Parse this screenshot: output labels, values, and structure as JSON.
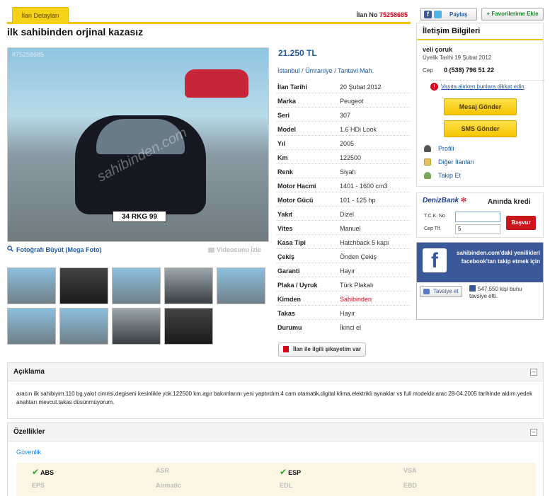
{
  "tabs": {
    "active": "İlan Detayları"
  },
  "listing": {
    "no_label": "İlan No",
    "no_value": "75258685",
    "title": "ilk sahibinden orjinal kazasız",
    "price": "21.250 TL",
    "location": [
      "İstanbul",
      "Ümraniye",
      "Tantavi Mah."
    ],
    "photo_watermark_id": "#75258685",
    "plate": "34 RKG 99",
    "watermark": "sahibinden.com"
  },
  "photo_actions": {
    "enlarge": "Fotoğrafı Büyüt (Mega Foto)",
    "video": "Videosunu İzle"
  },
  "details": [
    {
      "k": "İlan Tarihi",
      "v": "20 Şubat 2012"
    },
    {
      "k": "Marka",
      "v": "Peugeot"
    },
    {
      "k": "Seri",
      "v": "307"
    },
    {
      "k": "Model",
      "v": "1.6 HDi Look"
    },
    {
      "k": "Yıl",
      "v": "2005"
    },
    {
      "k": "Km",
      "v": "122500"
    },
    {
      "k": "Renk",
      "v": "Siyah"
    },
    {
      "k": "Motor Hacmi",
      "v": "1401 - 1600 cm3"
    },
    {
      "k": "Motor Gücü",
      "v": "101 - 125 hp"
    },
    {
      "k": "Yakıt",
      "v": "Dizel"
    },
    {
      "k": "Vites",
      "v": "Manuel"
    },
    {
      "k": "Kasa Tipi",
      "v": "Hatchback 5 kapı"
    },
    {
      "k": "Çekiş",
      "v": "Önden Çekiş"
    },
    {
      "k": "Garanti",
      "v": "Hayır"
    },
    {
      "k": "Plaka / Uyruk",
      "v": "Türk Plakalı"
    },
    {
      "k": "Kimden",
      "v": "Sahibinden"
    },
    {
      "k": "Takas",
      "v": "Hayır"
    },
    {
      "k": "Durumu",
      "v": "İkinci el"
    }
  ],
  "complain": "İlan ile ilgili şikayetim var",
  "top_buttons": {
    "share": "Paylaş",
    "fav": "+ Favorilerime Ekle"
  },
  "contact": {
    "title": "İletişim Bilgileri",
    "seller": "veli çoruk",
    "since": "Üyelik Tarihi 19 Şubat 2012",
    "phone_label": "Cep",
    "phone": "0 (538) 796 51 22",
    "warning": "Vasıta alırken bunlara dikkat edin",
    "message_btn": "Mesaj Gönder",
    "sms_btn": "SMS Gönder",
    "links": [
      "Profili",
      "Diğer İlanları",
      "Takip Et"
    ]
  },
  "bank": {
    "logo": "DenizBank",
    "tagline": "Anında kredi",
    "tck_label": "T.C.K. No",
    "cep_label": "Cep Tlf.",
    "cep_value": "5",
    "apply": "Başvur"
  },
  "facebook": {
    "promo": "sahibinden.com'daki yenilikleri facebook'tan takip etmek için",
    "like": "Tavsiye et",
    "count": "547.550 kişi bunu tavsiye etti."
  },
  "description": {
    "title": "Açıklama",
    "text": "aracın ilk sahibiyim.110 bg.yakıt cimrisi,degiseni kesinlikle yok.122500 km.agır bakımlarını yeni yaptırdım.4 cam otamatik,digital klima,elektrikli aynaklar vs full modeldir.arac 28-04.2005 tarihinde aldım.yedek anahtarı mevcut.takas düsünmüyorum."
  },
  "features": {
    "title": "Özellikler",
    "category": "Güvenlik",
    "items": [
      {
        "label": "ABS",
        "on": true
      },
      {
        "label": "ASR",
        "on": false
      },
      {
        "label": "ESP",
        "on": true
      },
      {
        "label": "VSA",
        "on": false
      },
      {
        "label": "EPS",
        "on": false
      },
      {
        "label": "Airmatic",
        "on": false
      },
      {
        "label": "EDL",
        "on": false
      },
      {
        "label": "EBD",
        "on": false
      }
    ]
  }
}
